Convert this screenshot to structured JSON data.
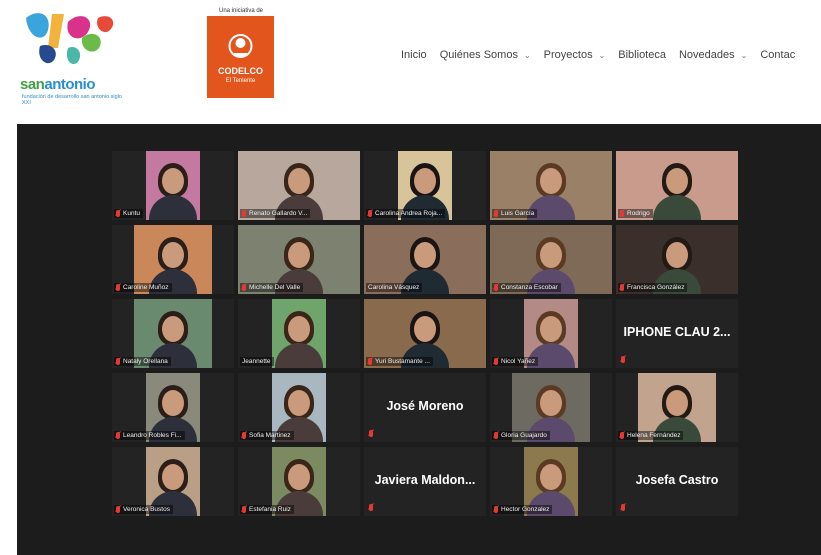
{
  "header": {
    "logo": {
      "word": "san antonio",
      "word_part1": "san",
      "word_part2": "antonio",
      "tagline": "fundación de desarrollo san antonio siglo XXI"
    },
    "initiative": {
      "label": "Una iniciativa de",
      "brand": "CODELCO",
      "sub": "El Teniente"
    },
    "nav": [
      {
        "label": "Inicio",
        "dropdown": false
      },
      {
        "label": "Quiénes Somos",
        "dropdown": true
      },
      {
        "label": "Proyectos",
        "dropdown": true
      },
      {
        "label": "Biblioteca",
        "dropdown": false
      },
      {
        "label": "Novedades",
        "dropdown": true
      },
      {
        "label": "Contac",
        "dropdown": false
      }
    ]
  },
  "colors": {
    "accent_orange": "#e2551c",
    "active_speaker": "#9bd33c",
    "muted_mic": "#e53935",
    "meeting_bg": "#1c1c1c"
  },
  "participants": [
    {
      "name": "Kuntu",
      "video": true,
      "muted": true,
      "frame": "narrow",
      "bg": "#c47aa0"
    },
    {
      "name": "Renato Gallardo V...",
      "video": true,
      "muted": true,
      "frame": "wide",
      "bg": "#b7a79c"
    },
    {
      "name": "Carolina Andrea Roja...",
      "video": true,
      "muted": true,
      "frame": "narrow",
      "bg": "#d8c49a"
    },
    {
      "name": "Luis García",
      "video": true,
      "muted": true,
      "frame": "wide",
      "bg": "#9a8066"
    },
    {
      "name": "Rodrigo",
      "video": true,
      "muted": true,
      "frame": "wide",
      "bg": "#c89b8c"
    },
    {
      "name": "Caroline Muñoz",
      "video": true,
      "muted": true,
      "frame": "mid",
      "bg": "#c9875a"
    },
    {
      "name": "Michelle Del Valle",
      "video": true,
      "muted": true,
      "frame": "wide",
      "bg": "#7d8270"
    },
    {
      "name": "Carolina Vásquez",
      "video": true,
      "muted": false,
      "frame": "wide",
      "bg": "#8a6d5a",
      "active": true
    },
    {
      "name": "Constanza Escobar",
      "video": true,
      "muted": true,
      "frame": "wide",
      "bg": "#7f6a58"
    },
    {
      "name": "Francisca González",
      "video": true,
      "muted": true,
      "frame": "wide",
      "bg": "#3a2f2a"
    },
    {
      "name": "Nataly Orellana",
      "video": true,
      "muted": true,
      "frame": "mid",
      "bg": "#6a8a6f"
    },
    {
      "name": "Jeannette",
      "video": true,
      "muted": false,
      "frame": "narrow",
      "bg": "#6fa46a"
    },
    {
      "name": "Yuri Bustamante ...",
      "video": true,
      "muted": true,
      "frame": "wide",
      "bg": "#8a6a4c"
    },
    {
      "name": "Nicol Yañez",
      "video": true,
      "muted": true,
      "frame": "narrow",
      "bg": "#b48a86"
    },
    {
      "name": "IPHONE CLAU 2...",
      "video": false,
      "muted": true
    },
    {
      "name": "Leandro Robles Fi...",
      "video": true,
      "muted": true,
      "frame": "narrow",
      "bg": "#8a8a7c"
    },
    {
      "name": "Sofia Martinez",
      "video": true,
      "muted": true,
      "frame": "narrow",
      "bg": "#a9b8c0"
    },
    {
      "name": "José Moreno",
      "video": false,
      "muted": true
    },
    {
      "name": "Gloria Guajardo",
      "video": true,
      "muted": true,
      "frame": "mid",
      "bg": "#6d6a62"
    },
    {
      "name": "Helena Fernández",
      "video": true,
      "muted": true,
      "frame": "mid",
      "bg": "#c2a48e"
    },
    {
      "name": "Veronica Bustos",
      "video": true,
      "muted": true,
      "frame": "narrow",
      "bg": "#b99f86"
    },
    {
      "name": "Estefania Ruiz",
      "video": true,
      "muted": true,
      "frame": "narrow",
      "bg": "#7c8a62"
    },
    {
      "name": "Javiera  Maldon...",
      "video": false,
      "muted": true
    },
    {
      "name": "Hector Gonzalez",
      "video": true,
      "muted": true,
      "frame": "narrow",
      "bg": "#8c7a4e"
    },
    {
      "name": "Josefa Castro",
      "video": false,
      "muted": true
    }
  ]
}
